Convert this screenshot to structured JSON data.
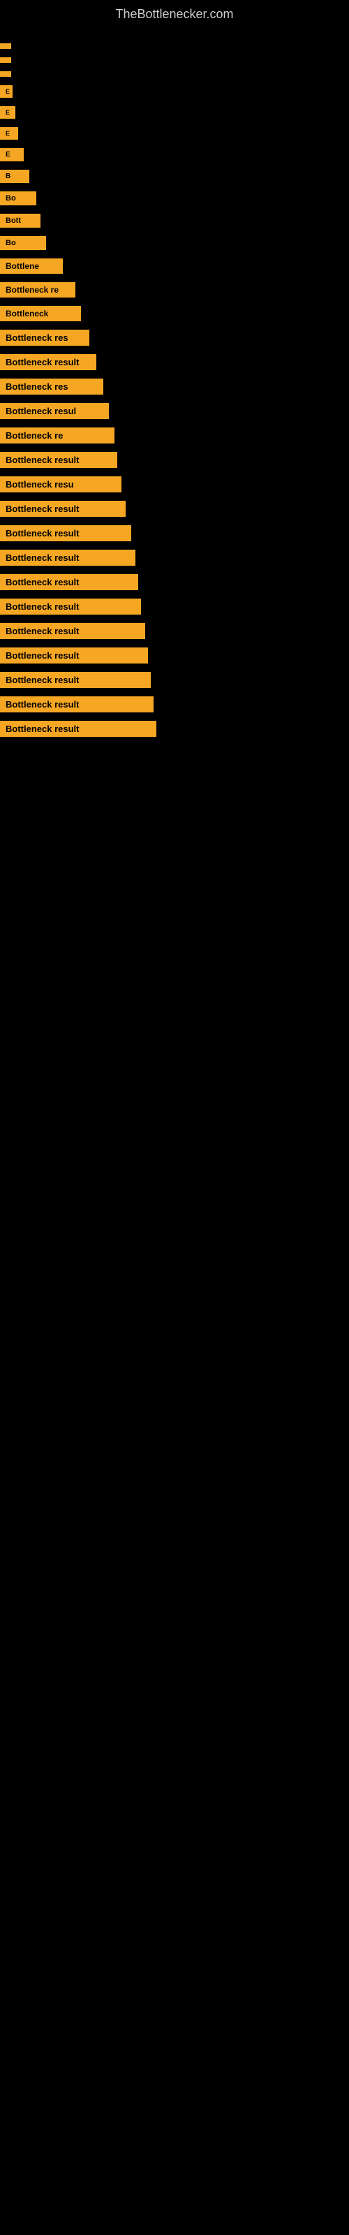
{
  "site": {
    "title": "TheBottlenecker.com"
  },
  "rows": [
    {
      "index": 0,
      "label": ""
    },
    {
      "index": 1,
      "label": ""
    },
    {
      "index": 2,
      "label": ""
    },
    {
      "index": 3,
      "label": "E"
    },
    {
      "index": 4,
      "label": "E"
    },
    {
      "index": 5,
      "label": "E"
    },
    {
      "index": 6,
      "label": "E"
    },
    {
      "index": 7,
      "label": "B"
    },
    {
      "index": 8,
      "label": "Bo"
    },
    {
      "index": 9,
      "label": "Bott"
    },
    {
      "index": 10,
      "label": "Bo"
    },
    {
      "index": 11,
      "label": "Bottlene"
    },
    {
      "index": 12,
      "label": "Bottleneck re"
    },
    {
      "index": 13,
      "label": "Bottleneck"
    },
    {
      "index": 14,
      "label": "Bottleneck res"
    },
    {
      "index": 15,
      "label": "Bottleneck result"
    },
    {
      "index": 16,
      "label": "Bottleneck res"
    },
    {
      "index": 17,
      "label": "Bottleneck resul"
    },
    {
      "index": 18,
      "label": "Bottleneck re"
    },
    {
      "index": 19,
      "label": "Bottleneck result"
    },
    {
      "index": 20,
      "label": "Bottleneck resu"
    },
    {
      "index": 21,
      "label": "Bottleneck result"
    },
    {
      "index": 22,
      "label": "Bottleneck result"
    },
    {
      "index": 23,
      "label": "Bottleneck result"
    },
    {
      "index": 24,
      "label": "Bottleneck result"
    },
    {
      "index": 25,
      "label": "Bottleneck result"
    },
    {
      "index": 26,
      "label": "Bottleneck result"
    },
    {
      "index": 27,
      "label": "Bottleneck result"
    },
    {
      "index": 28,
      "label": "Bottleneck result"
    },
    {
      "index": 29,
      "label": "Bottleneck result"
    },
    {
      "index": 30,
      "label": "Bottleneck result"
    }
  ]
}
